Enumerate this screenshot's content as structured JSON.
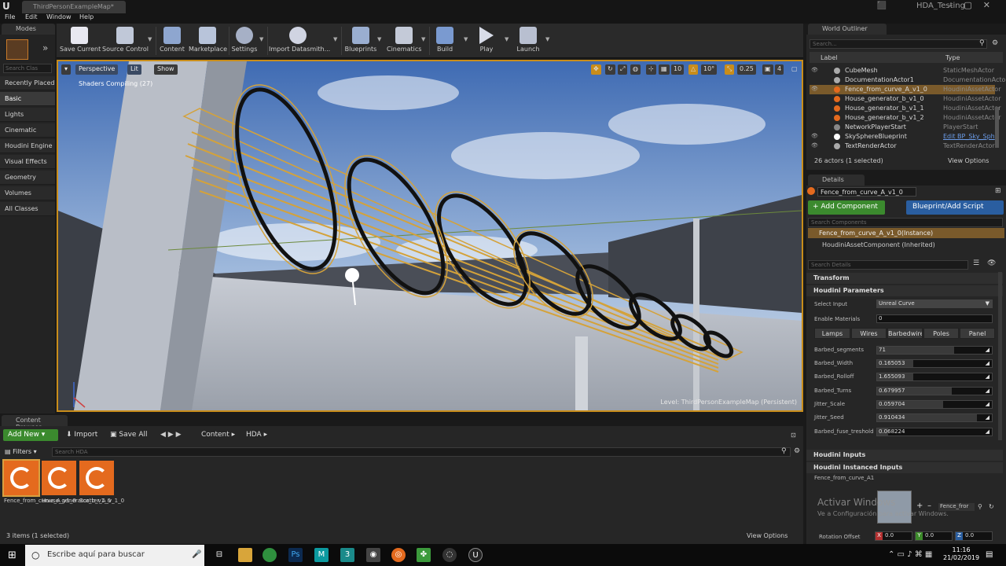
{
  "window": {
    "tab_title": "ThirdPersonExampleMap*",
    "project": "HDA_Testing"
  },
  "menu": [
    "File",
    "Edit",
    "Window",
    "Help"
  ],
  "modes": {
    "tab": "Modes",
    "search_placeholder": "Search Clas",
    "categories": [
      "Recently Placed",
      "Basic",
      "Lights",
      "Cinematic",
      "Houdini Engine",
      "Visual Effects",
      "Geometry",
      "Volumes",
      "All Classes"
    ]
  },
  "toolbar": {
    "save_current": "Save Current",
    "source_control": "Source Control",
    "content": "Content",
    "marketplace": "Marketplace",
    "settings": "Settings",
    "import_datasmith": "Import Datasmith...",
    "blueprints": "Blueprints",
    "cinematics": "Cinematics",
    "build": "Build",
    "play": "Play",
    "launch": "Launch"
  },
  "viewport": {
    "perspective": "Perspective",
    "lit": "Lit",
    "show": "Show",
    "shaders": "Shaders Compiling (27)",
    "grid_snap": "10",
    "rot_snap": "10°",
    "scale_snap": "0.25",
    "cam_speed": "4",
    "level": "Level:  ThirdPersonExampleMap (Persistent)"
  },
  "outliner": {
    "tab": "World Outliner",
    "search_placeholder": "Search...",
    "col_label": "Label",
    "col_type": "Type",
    "rows": [
      {
        "label": "CubeMesh",
        "type": "StaticMeshActor"
      },
      {
        "label": "DocumentationActor1",
        "type": "DocumentationActor"
      },
      {
        "label": "Fence_from_curve_A_v1_0",
        "type": "HoudiniAssetActor"
      },
      {
        "label": "House_generator_b_v1_0",
        "type": "HoudiniAssetActor"
      },
      {
        "label": "House_generator_b_v1_1",
        "type": "HoudiniAssetActor"
      },
      {
        "label": "House_generator_b_v1_2",
        "type": "HoudiniAssetActor"
      },
      {
        "label": "NetworkPlayerStart",
        "type": "PlayerStart"
      },
      {
        "label": "SkySphereBlueprint",
        "type": "Edit BP_Sky_Sph"
      },
      {
        "label": "TextRenderActor",
        "type": "TextRenderActor"
      }
    ],
    "count": "26 actors (1 selected)",
    "view_options": "View Options"
  },
  "details": {
    "tab": "Details",
    "name": "Fence_from_curve_A_v1_0",
    "add_component": "+ Add Component",
    "bp_script": "Blueprint/Add Script",
    "search_components": "Search Components",
    "instance": "Fence_from_curve_A_v1_0(Instance)",
    "houdini_component": "HoudiniAssetComponent (Inherited)",
    "search_details": "Search Details",
    "transform": "Transform",
    "houdini_params": "Houdini Parameters",
    "select_input_label": "Select Input",
    "select_input_value": "Unreal Curve",
    "enable_materials_label": "Enable Materials",
    "enable_materials_value": "0",
    "param_tabs": [
      "Lamps",
      "Wires",
      "Barbedwire",
      "Poles",
      "Panel"
    ],
    "params": [
      {
        "label": "Barbed_segments",
        "value": "71",
        "fill": 0.7
      },
      {
        "label": "Barbed_Width",
        "value": "0.165053",
        "fill": 0.33
      },
      {
        "label": "Barbed_Rolloff",
        "value": "1.655093",
        "fill": 0.33
      },
      {
        "label": "Barbed_Turns",
        "value": "0.679957",
        "fill": 0.68
      },
      {
        "label": "Jitter_Scale",
        "value": "0.059704",
        "fill": 0.6
      },
      {
        "label": "Jitter_Seed",
        "value": "0.910434",
        "fill": 0.91
      },
      {
        "label": "Barbed_fuse_treshold",
        "value": "0.068224",
        "fill": 0.1
      }
    ],
    "houdini_inputs": "Houdini Inputs",
    "houdini_instanced": "Houdini Instanced Inputs",
    "instanced_name": "Fence_from_curve_A1",
    "fence_select": "Fence_fror",
    "rotation_offset": "Rotation Offset",
    "rot_x": "0.0",
    "rot_y": "0.0",
    "rot_z": "0.0",
    "watermark1": "Activar Windows",
    "watermark2": "Ve a Configuración para activar Windows."
  },
  "content_browser": {
    "tab": "Content Browser",
    "add_new": "Add New",
    "import": "Import",
    "save_all": "Save All",
    "path1": "Content",
    "path2": "HDA",
    "filters": "Filters",
    "search_placeholder": "Search HDA",
    "assets": [
      {
        "name": "Fence_from_curve_A_v1_0"
      },
      {
        "name": "House_generator_b_v1_0"
      },
      {
        "name": "Scatter_A_v_1_0"
      }
    ],
    "count": "3 items (1 selected)",
    "view_options": "View Options"
  },
  "taskbar": {
    "search": "Escribe aquí para buscar",
    "time": "11:16",
    "date": "21/02/2019"
  }
}
